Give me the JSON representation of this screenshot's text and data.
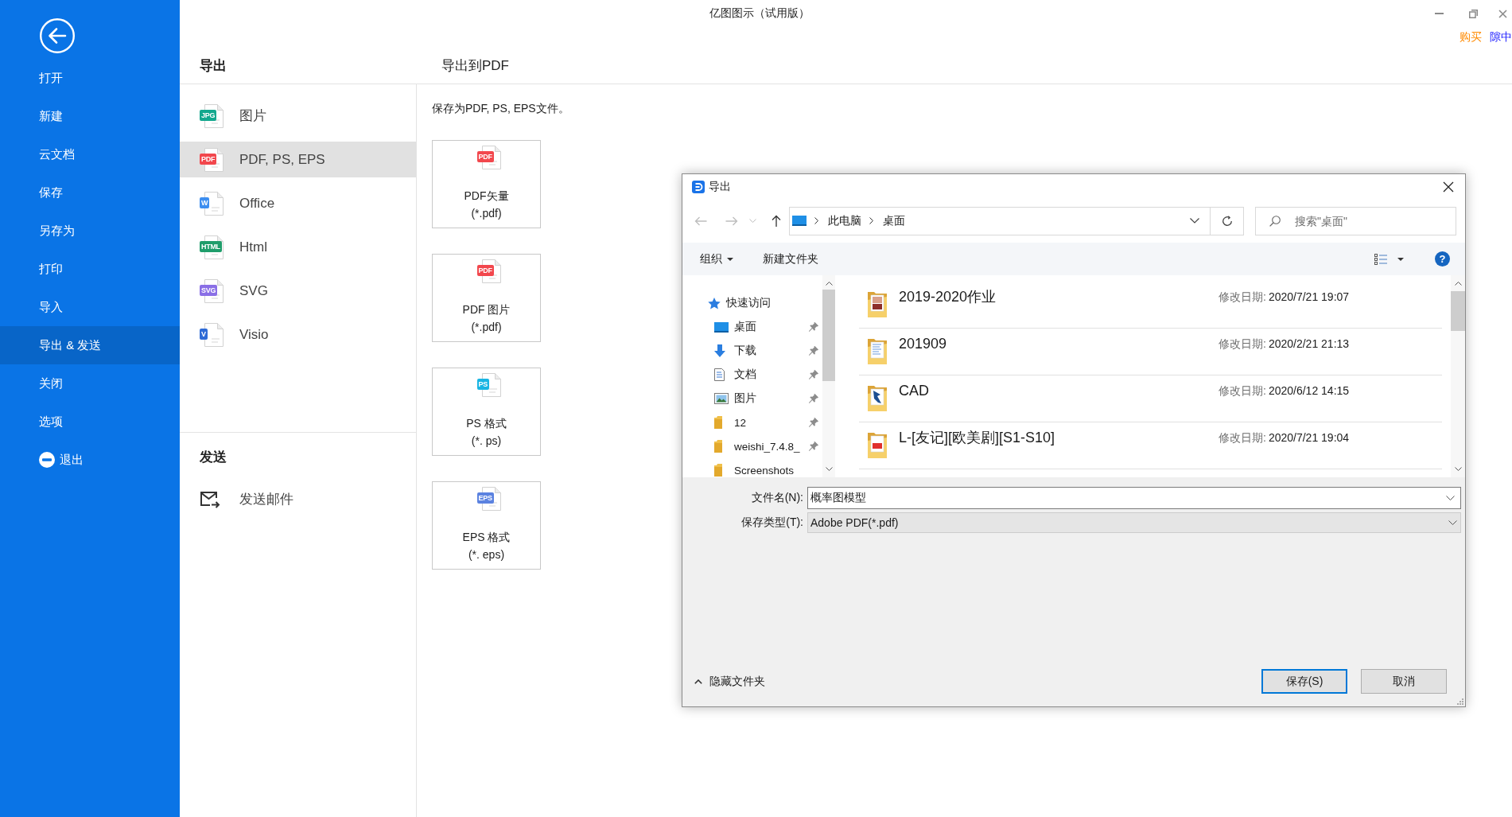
{
  "window": {
    "title": "亿图图示（试用版）",
    "links": [
      {
        "text": "购买",
        "color": "#ff8a00"
      },
      {
        "text": "隙中",
        "color": "#1a1aff"
      }
    ]
  },
  "sidebar": {
    "items": [
      {
        "label": "打开",
        "kind": "item",
        "selected": false
      },
      {
        "label": "新建",
        "kind": "item",
        "selected": false
      },
      {
        "label": "云文档",
        "kind": "item",
        "selected": false
      },
      {
        "label": "保存",
        "kind": "item",
        "selected": false
      },
      {
        "label": "另存为",
        "kind": "item",
        "selected": false
      },
      {
        "label": "打印",
        "kind": "item",
        "selected": false
      },
      {
        "label": "导入",
        "kind": "item",
        "selected": false
      },
      {
        "label": "导出 & 发送",
        "kind": "item",
        "selected": true
      },
      {
        "label": "关闭",
        "kind": "item",
        "selected": false
      },
      {
        "label": "选项",
        "kind": "item",
        "selected": false
      },
      {
        "label": "退出",
        "kind": "exit",
        "selected": false
      }
    ]
  },
  "export_panel": {
    "heading": "导出",
    "formats": [
      {
        "label": "图片",
        "badge": "JPG",
        "color": "#14a88e",
        "selected": false
      },
      {
        "label": "PDF, PS, EPS",
        "badge": "PDF",
        "color": "#f2474d",
        "selected": true
      },
      {
        "label": "Office",
        "badge": "W",
        "color": "#3d8ef0",
        "selected": false
      },
      {
        "label": "Html",
        "badge": "HTML",
        "color": "#1f9d6b",
        "selected": false
      },
      {
        "label": "SVG",
        "badge": "SVG",
        "color": "#8a6fe6",
        "selected": false
      },
      {
        "label": "Visio",
        "badge": "V",
        "color": "#2f6bd6",
        "selected": false
      }
    ]
  },
  "send_section": {
    "heading": "发送",
    "items": [
      {
        "label": "发送邮件"
      }
    ]
  },
  "content": {
    "title": "导出到PDF",
    "description": "保存为PDF, PS, EPS文件。",
    "options": [
      {
        "label": "PDF矢量",
        "extension": "(*.pdf)",
        "badge": "PDF",
        "color": "#f2474d"
      },
      {
        "label": "PDF 图片",
        "extension": "(*.pdf)",
        "badge": "PDF",
        "color": "#f2474d"
      },
      {
        "label": "PS 格式",
        "extension": "(*. ps)",
        "badge": "PS",
        "color": "#19b5e3"
      },
      {
        "label": "EPS 格式",
        "extension": "(*. eps)",
        "badge": "EPS",
        "color": "#5b82e0"
      }
    ]
  },
  "dialog": {
    "title": "导出",
    "breadcrumb": [
      "此电脑",
      "桌面"
    ],
    "search": {
      "placeholder": "搜索\"桌面\""
    },
    "toolbar": [
      {
        "label": "组织",
        "kind": "menu"
      },
      {
        "label": "新建文件夹",
        "kind": "button"
      }
    ],
    "help": "?",
    "nav_tree": [
      {
        "label": "快速访问",
        "kind": "star",
        "children": [
          {
            "label": "桌面",
            "kind": "desktop",
            "pinned": true
          },
          {
            "label": "下载",
            "kind": "download",
            "pinned": true
          },
          {
            "label": "文档",
            "kind": "document",
            "pinned": true
          },
          {
            "label": "图片",
            "kind": "picture",
            "pinned": true
          },
          {
            "label": "12",
            "kind": "folder",
            "pinned": true
          },
          {
            "label": "weishi_7.4.8_",
            "kind": "folder",
            "pinned": true
          },
          {
            "label": "Screenshots",
            "kind": "folder",
            "pinned": false
          }
        ]
      }
    ],
    "files": [
      {
        "name": "2019-2020作业",
        "kind": "photos",
        "date_label": "修改日期:",
        "date": "2020/7/21 19:07"
      },
      {
        "name": "201909",
        "kind": "documents",
        "date_label": "修改日期:",
        "date": "2020/2/21 21:13"
      },
      {
        "name": "CAD",
        "kind": "cad",
        "date_label": "修改日期:",
        "date": "2020/6/12 14:15"
      },
      {
        "name": "L-[友记][欧美剧][S1-S10]",
        "kind": "pdf",
        "date_label": "修改日期:",
        "date": "2020/7/21 19:04"
      }
    ],
    "file_name": {
      "label": "文件名(N):",
      "value": "概率图模型"
    },
    "file_type": {
      "label": "保存类型(T):",
      "value": "Adobe PDF(*.pdf)"
    },
    "hide_folders": "隐藏文件夹",
    "buttons": [
      {
        "label": "保存(S)",
        "default": true
      },
      {
        "label": "取消",
        "default": false
      }
    ]
  }
}
